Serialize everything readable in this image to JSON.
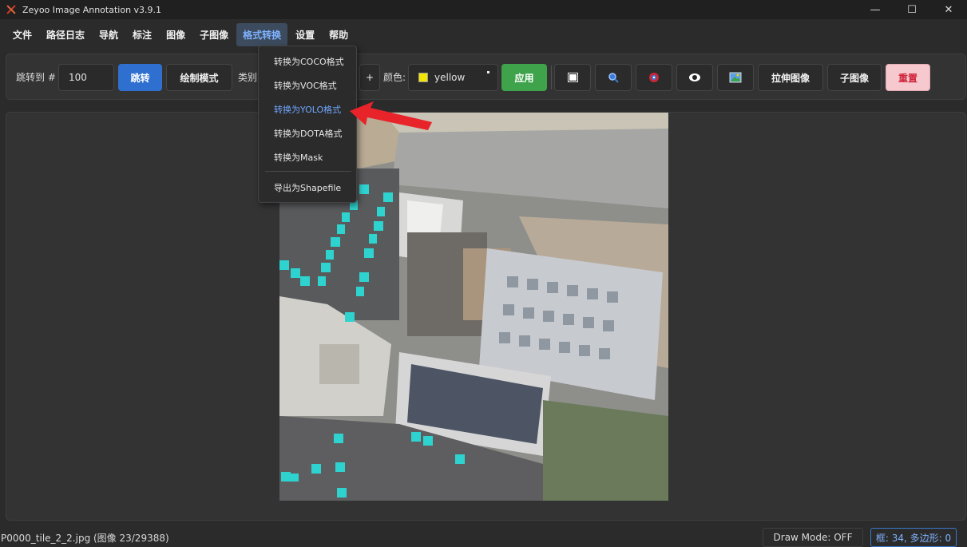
{
  "window": {
    "title": "Zeyoo Image Annotation v3.9.1",
    "minimize": "—",
    "maximize": "☐",
    "close": "✕"
  },
  "menu": [
    "文件",
    "路径日志",
    "导航",
    "标注",
    "图像",
    "子图像",
    "格式转换",
    "设置",
    "帮助"
  ],
  "toolbar": {
    "jump_label": "跳转到 #",
    "jump_value": "100",
    "jump_button": "跳转",
    "draw_mode_button": "绘制模式",
    "category_label": "类别",
    "add_button": "+",
    "color_label": "颜色:",
    "color_value": "yellow",
    "color_hex": "#f2e600",
    "apply_button": "应用",
    "stretch_button": "拉伸图像",
    "subimage_button": "子图像",
    "reset_button": "重置"
  },
  "dropdown": {
    "items": [
      "转换为COCO格式",
      "转换为VOC格式",
      "转换为YOLO格式",
      "转换为DOTA格式",
      "转换为Mask",
      "导出为Shapefile"
    ],
    "highlighted": "转换为YOLO格式"
  },
  "status": {
    "file": "P0000_tile_2_2.jpg (图像 23/29388)",
    "draw_mode": "Draw Mode: OFF",
    "counts": "框: 34, 多边形: 0"
  },
  "colors": {
    "accent": "#2f6fd0",
    "apply": "#3ea34a",
    "reset_bg": "#f6c9cf",
    "reset_text": "#d0253b",
    "annotation": "#2ed3d0",
    "arrow": "#e8232a"
  }
}
